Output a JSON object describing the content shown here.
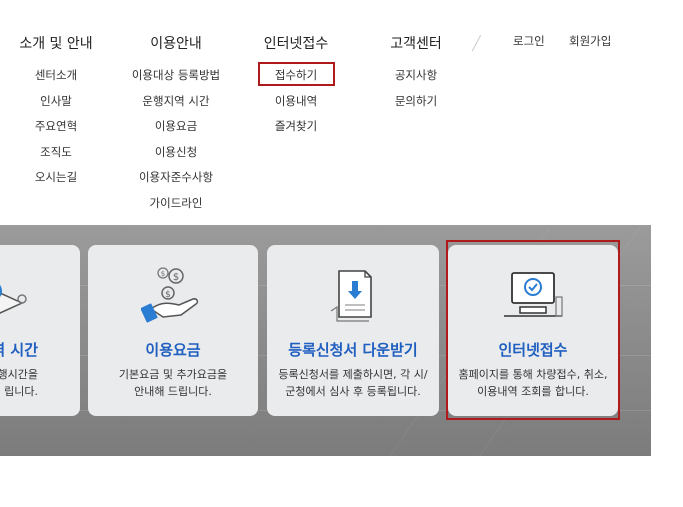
{
  "menu": {
    "intro": {
      "title": "소개 및 안내",
      "items": [
        "센터소개",
        "인사말",
        "주요연혁",
        "조직도",
        "오시는길"
      ]
    },
    "usage": {
      "title": "이용안내",
      "items": [
        "이용대상 등록방법",
        "운행지역 시간",
        "이용요금",
        "이용신청",
        "이용자준수사항",
        "가이드라인"
      ]
    },
    "internet": {
      "title": "인터넷접수",
      "items": [
        "접수하기",
        "이용내역",
        "즐겨찾기"
      ]
    },
    "cs": {
      "title": "고객센터",
      "items": [
        "공지사항",
        "문의하기"
      ]
    }
  },
  "util": {
    "login": "로그인",
    "join": "회원가입"
  },
  "cards": {
    "region": {
      "title": "역 시간",
      "desc_1": "운행시간을",
      "desc_2": "립니다.",
      "icon": "map-pin-icon"
    },
    "fee": {
      "title": "이용요금",
      "desc_1": "기본요금 및 추가요금을",
      "desc_2": "안내해 드립니다.",
      "icon": "coins-hand-icon"
    },
    "download": {
      "title": "등록신청서 다운받기",
      "desc_1": "등록신청서를 제출하시면, 각 시/",
      "desc_2": "군청에서 심사 후 등록됩니다.",
      "icon": "document-download-icon"
    },
    "internet": {
      "title": "인터넷접수",
      "desc_1": "홈페이지를 통해 차량접수, 취소,",
      "desc_2": "이용내역 조회를 합니다.",
      "icon": "monitor-check-icon"
    }
  },
  "colors": {
    "accent": "#1f5fc0",
    "highlight": "#b01a1a"
  }
}
